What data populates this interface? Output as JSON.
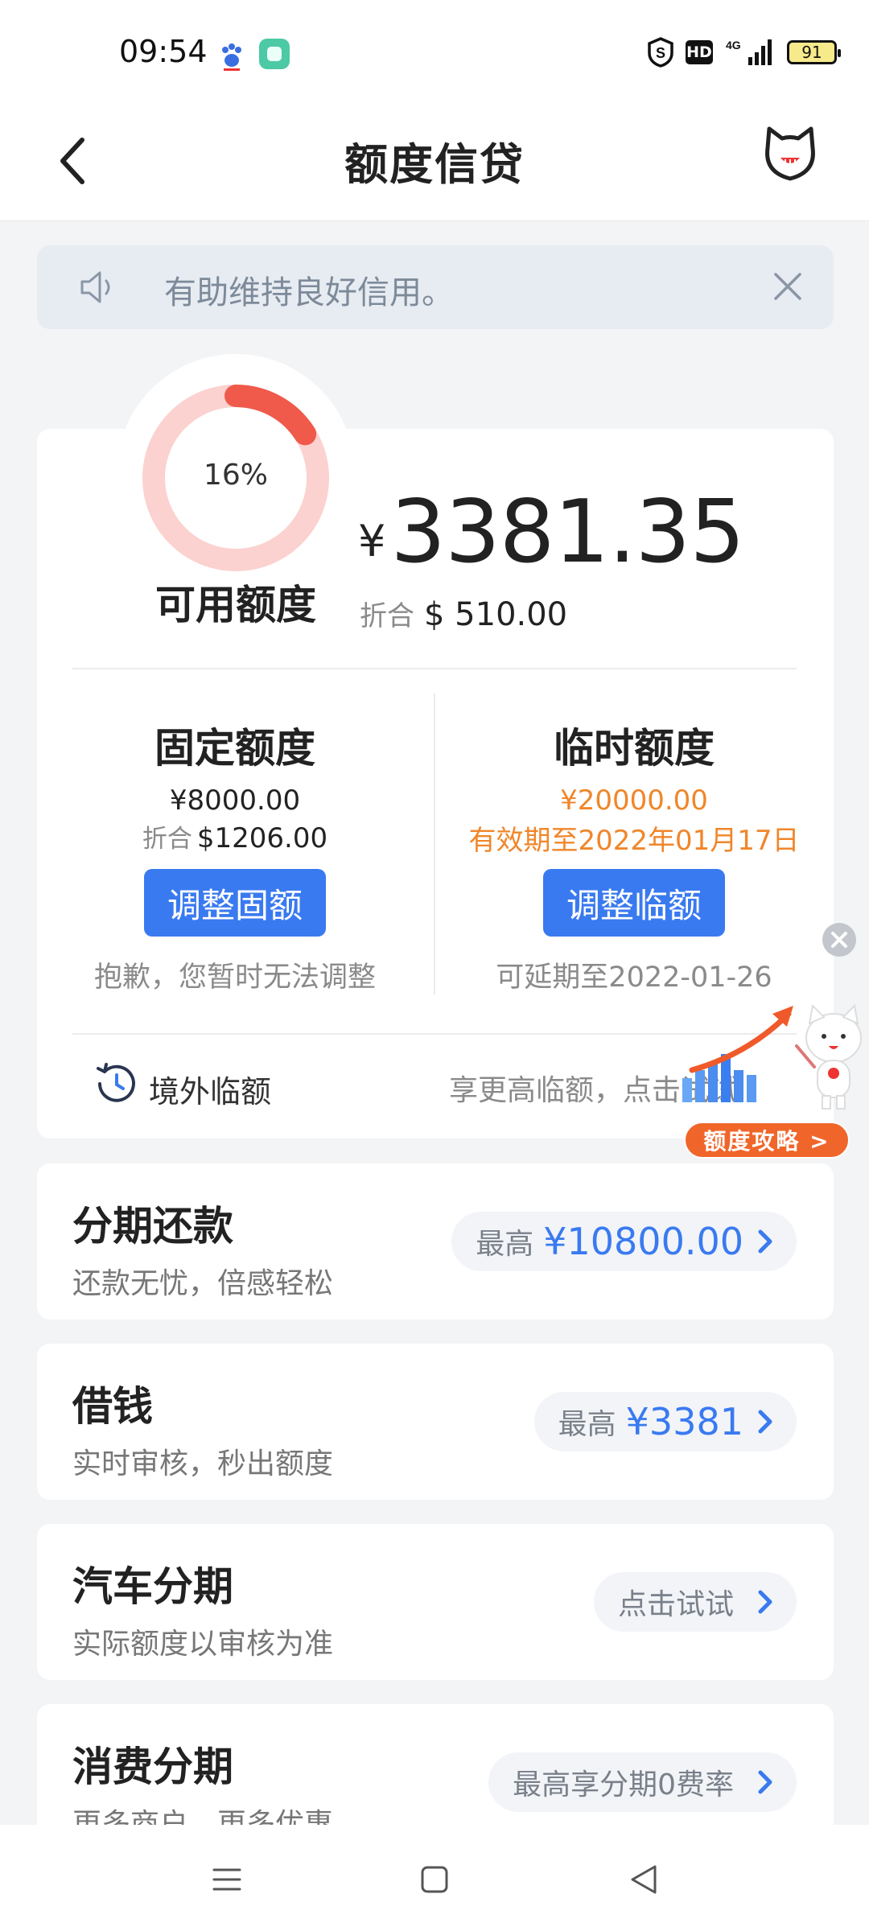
{
  "status_bar": {
    "time": "09:54",
    "hd_label": "HD",
    "network_label": "4G",
    "battery": "91"
  },
  "nav": {
    "title": "额度信贷",
    "back_icon": "chevron-left-icon",
    "mascot_icon": "cat-mascot-icon"
  },
  "notice": {
    "text": "有助维持良好信用。",
    "icon": "speaker-icon"
  },
  "credit": {
    "usage_percent": 16,
    "usage_percent_label": "16%",
    "available_label": "可用额度",
    "currency_symbol": "¥",
    "available_amount": "3381.35",
    "usd_prefix": "折合",
    "usd_amount": "$ 510.00"
  },
  "fixed": {
    "title": "固定额度",
    "amount": "¥8000.00",
    "usd_prefix": "折合",
    "usd_amount": "$1206.00",
    "button": "调整固额",
    "note": "抱歉，您暂时无法调整"
  },
  "temporary": {
    "title": "临时额度",
    "amount": "¥20000.00",
    "validity": "有效期至2022年01月17日",
    "button": "调整临额",
    "note": "可延期至2022-01-26"
  },
  "overseas": {
    "label": "境外临额",
    "hint": "享更高临额，点击试试"
  },
  "promo": {
    "button": "额度攻略 >"
  },
  "services": [
    {
      "title": "分期还款",
      "subtitle": "还款无忧，倍感轻松",
      "pill_prefix": "最高",
      "pill_value": "¥10800.00"
    },
    {
      "title": "借钱",
      "subtitle": "实时审核，秒出额度",
      "pill_prefix": "最高",
      "pill_value": "¥3381"
    },
    {
      "title": "汽车分期",
      "subtitle": "实际额度以审核为准",
      "pill_prefix": "点击试试",
      "pill_value": ""
    },
    {
      "title": "消费分期",
      "subtitle": "更多商户，更多优惠",
      "pill_prefix": "最高享分期0费率",
      "pill_value": ""
    }
  ],
  "colors": {
    "accent_blue": "#3a7af0",
    "ring_red": "#ef5a4a",
    "ring_track": "#fbd2cf",
    "temporary_orange": "#f0862a"
  }
}
